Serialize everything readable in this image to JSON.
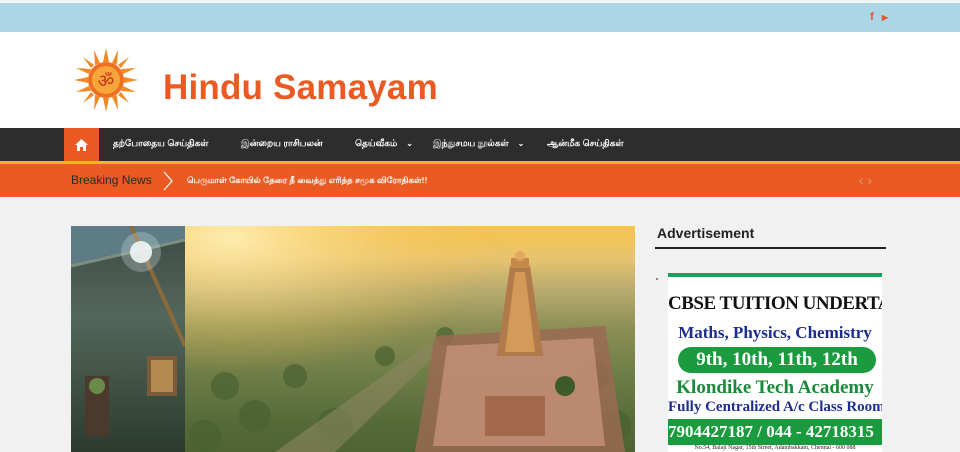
{
  "site": {
    "title": "Hindu Samayam"
  },
  "topbar": {
    "social": [
      {
        "icon": "facebook-icon",
        "glyph": "f"
      },
      {
        "icon": "youtube-icon",
        "glyph": "▶"
      }
    ]
  },
  "nav": {
    "home_icon": "home-icon",
    "items": [
      {
        "label": "தற்போதைய செய்திகள்",
        "has_dropdown": false
      },
      {
        "label": "இன்றைய ராசிபலன்",
        "has_dropdown": false
      },
      {
        "label": "தெய்வீகம்",
        "has_dropdown": true
      },
      {
        "label": "இந்துசமய நூல்கள்",
        "has_dropdown": true
      },
      {
        "label": "ஆன்மீக செய்திகள்",
        "has_dropdown": false
      }
    ]
  },
  "breaking": {
    "label": "Breaking News",
    "headline": "பெருமாள் கோயில் தேரை தீ வைத்து எரித்த சமூக விரோதிகள்!!"
  },
  "sidebar": {
    "title": "Advertisement"
  },
  "ad": {
    "line1": "CBSE TUITION UNDERTAKEN",
    "line2": "Maths, Physics, Chemistry",
    "grades": "9th, 10th, 11th, 12th",
    "academy": "Klondike Tech Academy",
    "feature": "Fully Centralized A/c Class Room",
    "phone": "7904427187 / 044 - 42718315",
    "address": "No.54, Balaji Nagar, 15th Street, Adambakkam, Chennai - 600 088"
  },
  "colors": {
    "accent": "#ea5a22",
    "nav_bg": "#2d2d2d",
    "topbar": "#acd6e6",
    "nav_line": "#f2b51b"
  }
}
